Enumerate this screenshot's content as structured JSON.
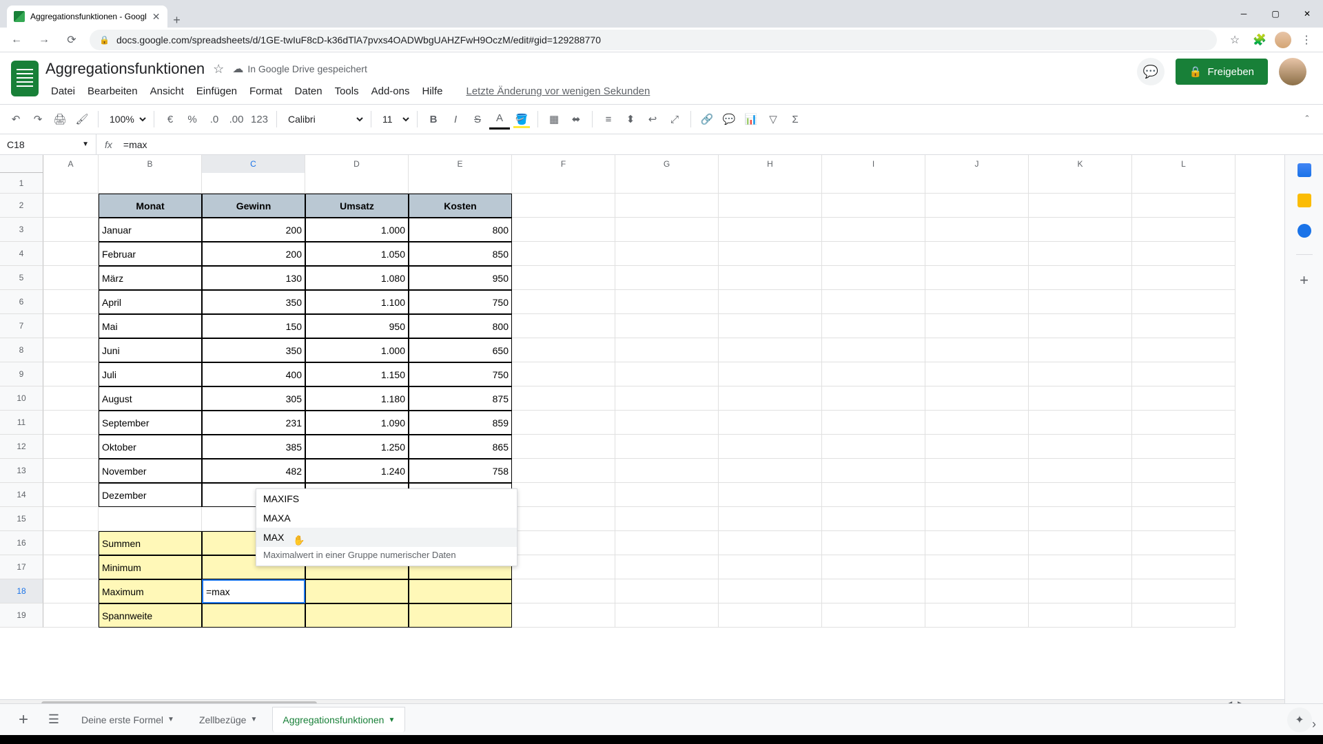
{
  "browser": {
    "tab_title": "Aggregationsfunktionen - Googl",
    "url": "docs.google.com/spreadsheets/d/1GE-twIuF8cD-k36dTlA7pvxs4OADWbgUAHZFwH9OczM/edit#gid=129288770"
  },
  "doc": {
    "title": "Aggregationsfunktionen",
    "saved": "In Google Drive gespeichert",
    "history": "Letzte Änderung vor wenigen Sekunden",
    "share": "Freigeben"
  },
  "menus": [
    "Datei",
    "Bearbeiten",
    "Ansicht",
    "Einfügen",
    "Format",
    "Daten",
    "Tools",
    "Add-ons",
    "Hilfe"
  ],
  "toolbar": {
    "zoom": "100%",
    "font": "Calibri",
    "size": "11",
    "numfmt": "123"
  },
  "formula": {
    "cell": "C18",
    "value": "=max"
  },
  "columns": [
    "A",
    "B",
    "C",
    "D",
    "E",
    "F",
    "G",
    "H",
    "I",
    "J",
    "K",
    "L"
  ],
  "table": {
    "headers": [
      "Monat",
      "Gewinn",
      "Umsatz",
      "Kosten"
    ],
    "rows": [
      {
        "m": "Januar",
        "g": "200",
        "u": "1.000",
        "k": "800"
      },
      {
        "m": "Februar",
        "g": "200",
        "u": "1.050",
        "k": "850"
      },
      {
        "m": "März",
        "g": "130",
        "u": "1.080",
        "k": "950"
      },
      {
        "m": "April",
        "g": "350",
        "u": "1.100",
        "k": "750"
      },
      {
        "m": "Mai",
        "g": "150",
        "u": "950",
        "k": "800"
      },
      {
        "m": "Juni",
        "g": "350",
        "u": "1.000",
        "k": "650"
      },
      {
        "m": "Juli",
        "g": "400",
        "u": "1.150",
        "k": "750"
      },
      {
        "m": "August",
        "g": "305",
        "u": "1.180",
        "k": "875"
      },
      {
        "m": "September",
        "g": "231",
        "u": "1.090",
        "k": "859"
      },
      {
        "m": "Oktober",
        "g": "385",
        "u": "1.250",
        "k": "865"
      },
      {
        "m": "November",
        "g": "482",
        "u": "1.240",
        "k": "758"
      },
      {
        "m": "Dezember",
        "g": "",
        "u": "",
        "k": ""
      }
    ],
    "summary": [
      "Summen",
      "Minimum",
      "Maximum",
      "Spannweite"
    ],
    "active_input": "=max"
  },
  "autocomplete": {
    "items": [
      "MAXIFS",
      "MAXA",
      "MAX"
    ],
    "desc": "Maximalwert in einer Gruppe numerischer Daten"
  },
  "sheets": {
    "tabs": [
      "Deine erste Formel",
      "Zellbezüge",
      "Aggregationsfunktionen"
    ],
    "active": 2
  }
}
